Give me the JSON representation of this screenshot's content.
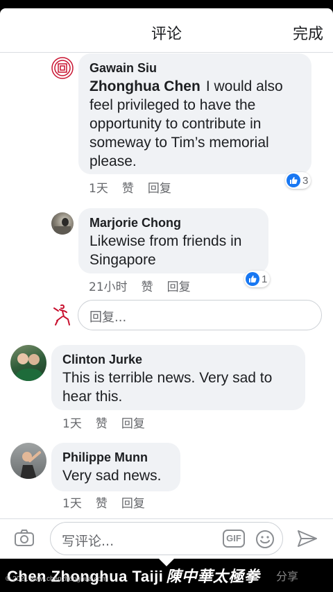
{
  "header": {
    "title": "评论",
    "done_label": "完成"
  },
  "comments": [
    {
      "author": "Gawain Siu",
      "mention": "Zhonghua Chen",
      "text": "I would also feel privileged to have the opportunity to contribute in someway to Tim’s memorial please.",
      "time": "1天",
      "like_label": "赞",
      "reply_label": "回复",
      "reaction_count": "3"
    },
    {
      "author": "Marjorie Chong",
      "text": "Likewise from friends in Singapore",
      "time": "21小时",
      "like_label": "赞",
      "reply_label": "回复",
      "reaction_count": "1"
    },
    {
      "author": "Clinton Jurke",
      "text": "This is terrible news. Very sad to hear this.",
      "time": "1天",
      "like_label": "赞",
      "reply_label": "回复"
    },
    {
      "author": "Philippe Munn",
      "text": "Very sad news.",
      "time": "1天",
      "like_label": "赞",
      "reply_label": "回复"
    }
  ],
  "reply_box": {
    "placeholder": "回复..."
  },
  "composer": {
    "placeholder": "写评论...",
    "gif_label": "GIF"
  },
  "watermark": {
    "title": "Chen Zhonghua Taiji",
    "title_cn": "陳中華太極拳",
    "subtitle": "© 2021 www.chenzhonghua.com",
    "share_label": "分享"
  },
  "colors": {
    "accent": "#1877f2",
    "bubble": "#f0f2f5",
    "meta": "#65676b"
  },
  "icons": [
    "camera-icon",
    "emoji-icon",
    "send-icon",
    "like-icon",
    "page-logo-icon",
    "taiji-figure-icon"
  ]
}
